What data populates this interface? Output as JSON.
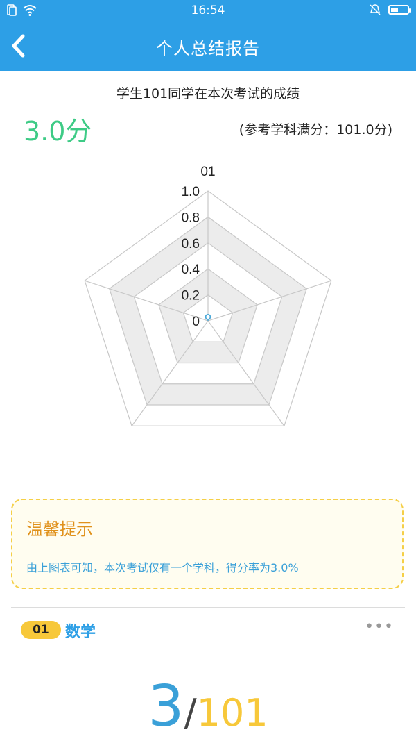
{
  "status_bar": {
    "time": "16:54",
    "battery_level": 0.45
  },
  "nav": {
    "title": "个人总结报告"
  },
  "report": {
    "subtitle": "学生101同学在本次考试的成绩",
    "score": "3.0分",
    "full_score": "(参考学科满分：101.0分)"
  },
  "chart_data": {
    "type": "radar",
    "axes": [
      "01",
      "",
      "",
      "",
      ""
    ],
    "rlim": [
      0,
      1.0
    ],
    "ticks": [
      "0",
      "0.2",
      "0.4",
      "0.6",
      "0.8",
      "1.0"
    ],
    "values": [
      0.03,
      0,
      0,
      0,
      0
    ],
    "ring_fill": [
      "#ffffff",
      "#ececec",
      "#ffffff",
      "#ececec",
      "#ffffff"
    ],
    "series_color": "#4aa8d8"
  },
  "tip": {
    "title": "温馨提示",
    "text": "由上图表可知，本次考试仅有一个学科，得分率为3.0%"
  },
  "subject": {
    "index": "01",
    "name": "数学",
    "more": "•••"
  },
  "result": {
    "score": "3",
    "slash": "/",
    "total": "101"
  },
  "colors": {
    "primary": "#2d9fe6",
    "score_green": "#3ecb86",
    "accent_yellow": "#f7c83a",
    "tip_orange": "#e0911b"
  }
}
